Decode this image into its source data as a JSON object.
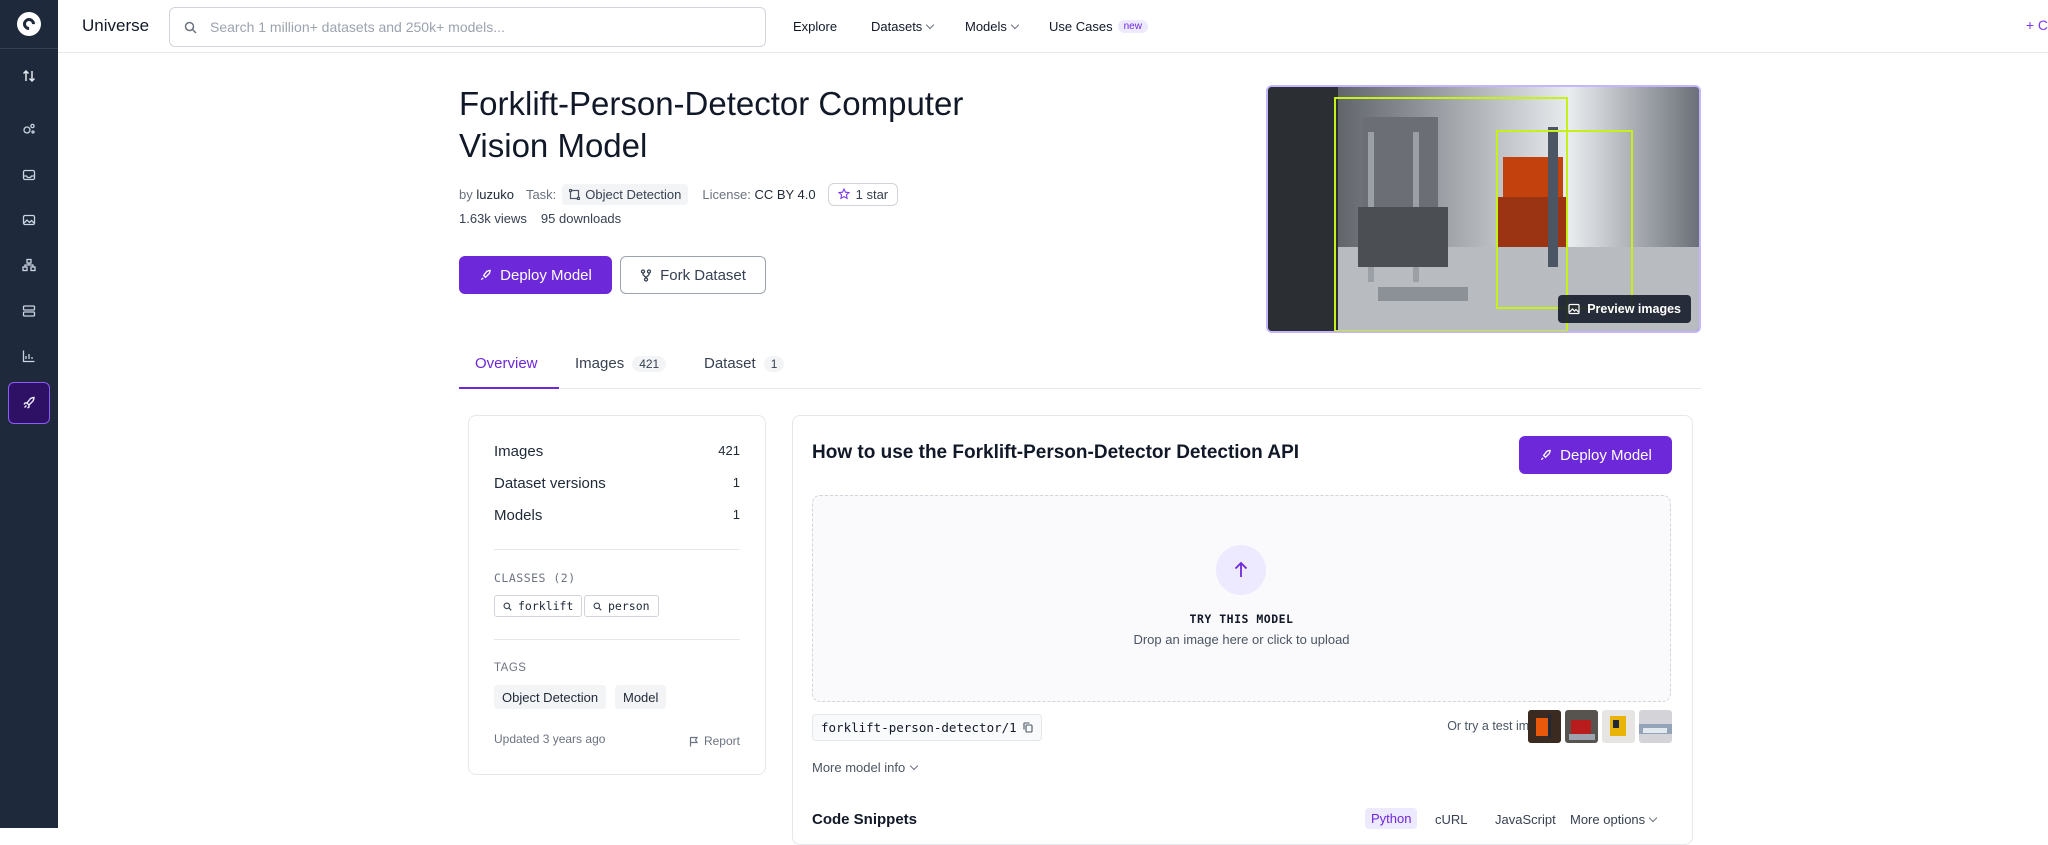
{
  "header": {
    "brand": "Universe",
    "search_placeholder": "Search 1 million+ datasets and 250k+ models...",
    "nav": [
      "Explore",
      "Datasets",
      "Models",
      "Use Cases"
    ],
    "new_badge": "new",
    "right_link": "+ C"
  },
  "model": {
    "title": "Forklift-Person-Detector Computer Vision Model",
    "by_label": "by",
    "author": "luzuko",
    "task_label": "Task:",
    "task": "Object Detection",
    "license_label": "License:",
    "license": "CC BY 4.0",
    "stars": "1 star",
    "views": "1.63k views",
    "downloads": "95 downloads",
    "deploy_label": "Deploy Model",
    "fork_label": "Fork Dataset",
    "preview_label": "Preview images"
  },
  "tabs": [
    {
      "label": "Overview",
      "count": ""
    },
    {
      "label": "Images",
      "count": "421"
    },
    {
      "label": "Dataset",
      "count": "1"
    }
  ],
  "sidebar_card": {
    "stats": [
      {
        "label": "Images",
        "value": "421"
      },
      {
        "label": "Dataset versions",
        "value": "1"
      },
      {
        "label": "Models",
        "value": "1"
      }
    ],
    "classes_label": "CLASSES (2)",
    "classes": [
      "forklift",
      "person"
    ],
    "tags_label": "TAGS",
    "tags": [
      "Object Detection",
      "Model"
    ],
    "updated": "Updated 3 years ago",
    "report": "Report"
  },
  "api_card": {
    "title": "How to use the Forklift-Person-Detector Detection API",
    "deploy_label": "Deploy Model",
    "try_title": "TRY THIS MODEL",
    "try_sub": "Drop an image here or click to upload",
    "model_id": "forklift-person-detector/1",
    "try_test": "Or try a test image",
    "more_info": "More model info",
    "code_title": "Code Snippets",
    "languages": [
      "Python",
      "cURL",
      "JavaScript",
      "More options"
    ]
  },
  "colors": {
    "accent": "#6d28d9",
    "rail": "#1e293b",
    "box": "#c6f01a"
  }
}
